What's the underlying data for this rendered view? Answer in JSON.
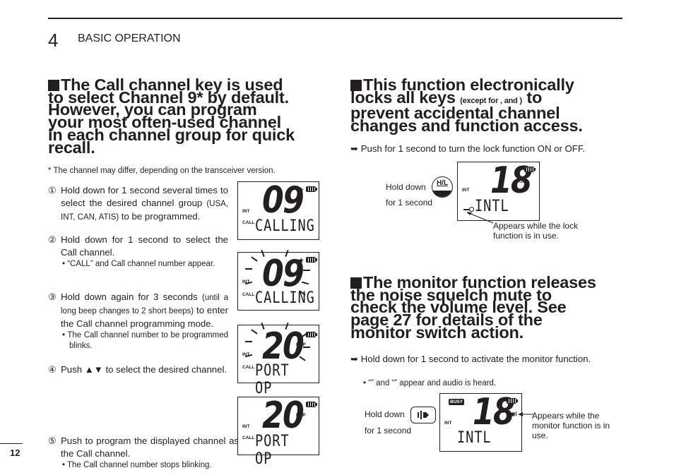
{
  "header": {
    "chapter_number": "4",
    "chapter_title": "BASIC OPERATION"
  },
  "call_section": {
    "headline_lines": [
      "The Call channel key is used",
      "to select Channel 9* by default.",
      "However, you can program",
      "your most often-used channel",
      "in each channel group for quick",
      "recall."
    ],
    "footnote": "* The channel may differ, depending on the transceiver version.",
    "steps": [
      {
        "num": "①",
        "text": "Hold down  for 1 second several times to select the desired channel group",
        "small": "(USA, INT, CAN, ATIS)",
        "tail": " to be programmed."
      },
      {
        "num": "②",
        "text": "Hold down  for 1 second to select the Call channel.",
        "bullet": "• “CALL” and Call channel number appear."
      },
      {
        "num": "③",
        "text": "Hold down  again for 3 seconds",
        "small": "(until a long beep changes to 2 short beeps)",
        "tail": " to enter the Call channel programming mode.",
        "bullet": "• The Call channel number to be programmed blinks."
      },
      {
        "num": "④",
        "text": "Push ▲▼ to select the desired channel."
      },
      {
        "num": "⑤",
        "text": "Push   to program the displayed channel as the Call channel.",
        "bullet": "• The Call channel number stops blinking."
      }
    ],
    "displays": [
      {
        "channel": "09",
        "text": "CALLING",
        "group": "INT",
        "call": "CALL",
        "star": "★",
        "blinking": false,
        "dup": ""
      },
      {
        "channel": "09",
        "text": "CALLING",
        "group": "INT",
        "call": "CALL",
        "star": "★",
        "blinking": true,
        "dup": ""
      },
      {
        "channel": "20",
        "text": "PORT OP",
        "group": "INT",
        "call": "CALL",
        "star": "",
        "blinking": true,
        "dup": "DUP"
      },
      {
        "channel": "20",
        "text": "PORT OP",
        "group": "INT",
        "call": "CALL",
        "star": "",
        "blinking": false,
        "dup": "DUP"
      }
    ]
  },
  "lock_section": {
    "headline_lines": [
      "This function electronically",
      "locks all keys",
      "prevent accidental channel",
      "changes and function access."
    ],
    "headline_small": "(except for ,  and )",
    "headline_to": "to",
    "instruction": "➥ Push  for 1 second to turn the lock function ON or OFF.",
    "hold_label": "Hold down",
    "hold_duration": "for 1 second",
    "key_label": "H/L",
    "display": {
      "channel": "18",
      "text": "INTL",
      "group": "INT",
      "dup": "DUP"
    },
    "callout": "Appears while the lock function is in use."
  },
  "monitor_section": {
    "headline_lines": [
      "The monitor function releases",
      "the noise squelch mute to",
      "check the volume level. See",
      "page 27 for details of the",
      "monitor switch action."
    ],
    "instruction": "➥ Hold down  for 1 second to activate the monitor function.",
    "bullet": "• “” and “” appear and audio is heard.",
    "hold_label": "Hold down",
    "hold_duration": "for 1 second",
    "display": {
      "channel": "18",
      "text": "INTL",
      "group": "INT",
      "dup": "DUP",
      "busy": "BUSY"
    },
    "callout": "Appears while the monitor function is in use."
  },
  "footer": {
    "page_number": "12"
  }
}
